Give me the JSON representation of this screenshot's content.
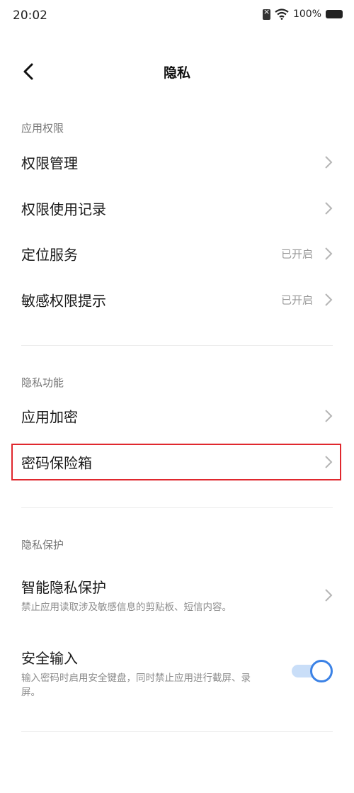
{
  "status_bar": {
    "time": "20:02",
    "battery": "100%"
  },
  "header": {
    "title": "隐私"
  },
  "sections": [
    {
      "label": "应用权限",
      "items": [
        {
          "title": "权限管理",
          "status": ""
        },
        {
          "title": "权限使用记录",
          "status": ""
        },
        {
          "title": "定位服务",
          "status": "已开启"
        },
        {
          "title": "敏感权限提示",
          "status": "已开启"
        }
      ]
    },
    {
      "label": "隐私功能",
      "items": [
        {
          "title": "应用加密"
        },
        {
          "title": "密码保险箱"
        }
      ]
    },
    {
      "label": "隐私保护",
      "items": [
        {
          "title": "智能隐私保护",
          "subtitle": "禁止应用读取涉及敏感信息的剪贴板、短信内容。"
        },
        {
          "title": "安全输入",
          "subtitle": "输入密码时启用安全键盘，同时禁止应用进行截屏、录屏。",
          "toggle_on": true
        }
      ]
    }
  ],
  "colors": {
    "accent": "#3b82e6",
    "highlight": "#e0282e",
    "toggle_track": "#c9def8"
  }
}
